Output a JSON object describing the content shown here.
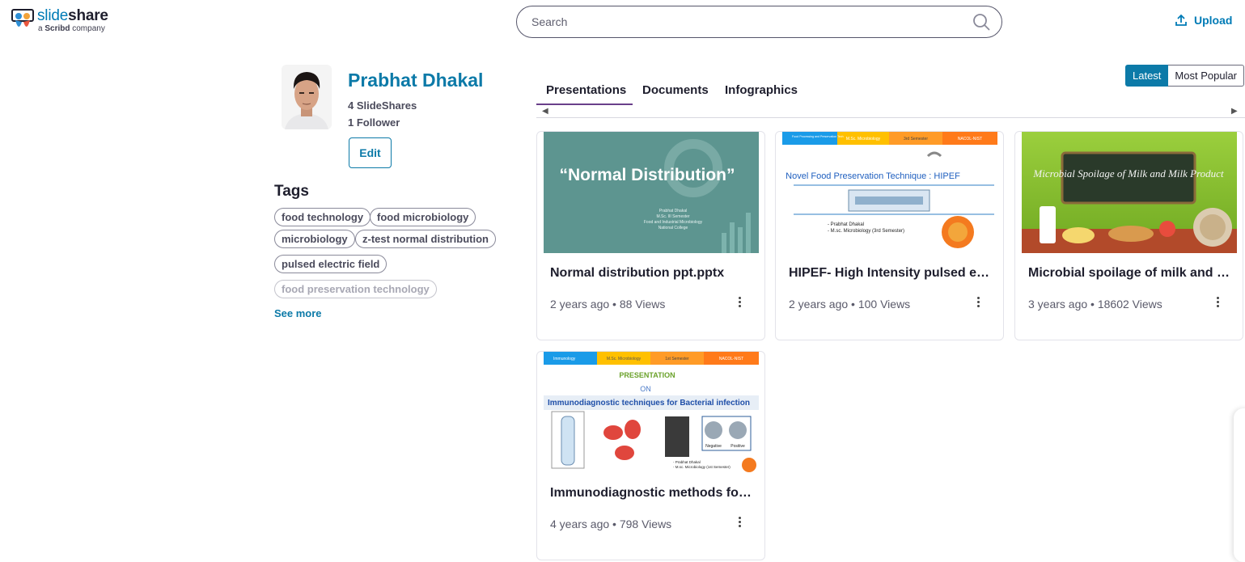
{
  "brand": {
    "name_light": "slide",
    "name_bold": "share",
    "sub_prefix": "a",
    "sub_brand": "Scribd",
    "sub_suffix": "company"
  },
  "search": {
    "placeholder": "Search"
  },
  "header": {
    "upload_label": "Upload"
  },
  "profile": {
    "name": "Prabhat Dhakal",
    "slideshares": "4 SlideShares",
    "followers": "1 Follower",
    "edit_label": "Edit"
  },
  "tags": {
    "title": "Tags",
    "items": [
      "food technology",
      "food microbiology",
      "microbiology",
      "z-test normal distribution",
      "pulsed electric field",
      "food preservation technology"
    ],
    "see_more": "See more"
  },
  "tabs": [
    "Presentations",
    "Documents",
    "Infographics"
  ],
  "active_tab": "Presentations",
  "sort": {
    "latest": "Latest",
    "popular": "Most Popular",
    "selected": "Latest"
  },
  "colors": {
    "accent": "#0c7aa8",
    "tab_underline": "#6a3f8a",
    "text": "#1e1e2d"
  },
  "cards": [
    {
      "title": "Normal distribution ppt.pptx",
      "meta": "2 years ago • 88 Views",
      "thumb": {
        "heading": "“Normal Distribution”",
        "lines": [
          "Prabhat Dhakal",
          "M.Sc. III Semester",
          "Food and Industrial Microbiology",
          "National College"
        ]
      }
    },
    {
      "title": "HIPEF- High Intensity pulsed electric field",
      "meta": "2 years ago • 100 Views",
      "thumb": {
        "bar": [
          "Food Processing and Preservation Tech",
          "M.Sc. Microbiology",
          "3rd Semester",
          "NACOL-NIST"
        ],
        "heading": "Novel Food Preservation Technique : HIPEF",
        "lines": [
          "- Prabhat Dhakal",
          "- M.sc. Microbiology (3rd Semester)"
        ]
      }
    },
    {
      "title": "Microbial spoilage of milk and milk product",
      "meta": "3 years ago • 18602 Views",
      "thumb": {
        "heading": "Microbial Spoilage of Milk and Milk Product"
      }
    },
    {
      "title": "Immunodiagnostic methods for bacterial infection",
      "meta": "4 years ago • 798 Views",
      "thumb": {
        "bar": [
          "Immunology",
          "M.Sc. Microbiology",
          "1st Semester",
          "NACOL-NIST"
        ],
        "pre": "PRESENTATION",
        "on": "ON",
        "heading": "Immunodiagnostic techniques for Bacterial infection",
        "labels": [
          "Negative",
          "Positive"
        ],
        "lines": [
          "- Prabhat Dhakal",
          "- M.sc. Microbiology (1st Semester)"
        ]
      }
    }
  ]
}
